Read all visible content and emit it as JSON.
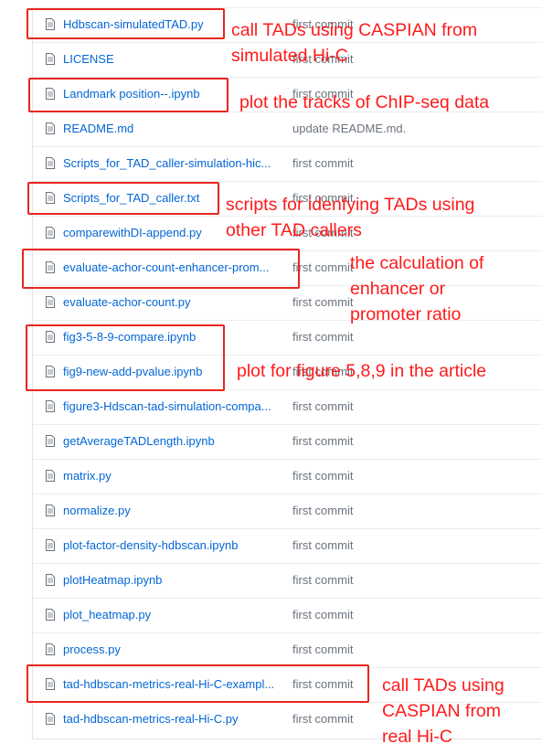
{
  "files": [
    {
      "name": "Hdbscan-simulatedTAD.py",
      "message": "first commit"
    },
    {
      "name": "LICENSE",
      "message": "first commit"
    },
    {
      "name": "Landmark position--.ipynb",
      "message": "first commit"
    },
    {
      "name": "README.md",
      "message": "update README.md."
    },
    {
      "name": "Scripts_for_TAD_caller-simulation-hic...",
      "message": "first commit"
    },
    {
      "name": "Scripts_for_TAD_caller.txt",
      "message": "first commit"
    },
    {
      "name": "comparewithDI-append.py",
      "message": "first commit"
    },
    {
      "name": "evaluate-achor-count-enhancer-prom...",
      "message": "first commit"
    },
    {
      "name": "evaluate-achor-count.py",
      "message": "first commit"
    },
    {
      "name": "fig3-5-8-9-compare.ipynb",
      "message": "first commit"
    },
    {
      "name": "fig9-new-add-pvalue.ipynb",
      "message": "first commit"
    },
    {
      "name": "figure3-Hdscan-tad-simulation-compa...",
      "message": "first commit"
    },
    {
      "name": "getAverageTADLength.ipynb",
      "message": "first commit"
    },
    {
      "name": "matrix.py",
      "message": "first commit"
    },
    {
      "name": "normalize.py",
      "message": "first commit"
    },
    {
      "name": "plot-factor-density-hdbscan.ipynb",
      "message": "first commit"
    },
    {
      "name": "plotHeatmap.ipynb",
      "message": "first commit"
    },
    {
      "name": "plot_heatmap.py",
      "message": "first commit"
    },
    {
      "name": "process.py",
      "message": "first commit"
    },
    {
      "name": "tad-hdbscan-metrics-real-Hi-C-exampl...",
      "message": "first commit"
    },
    {
      "name": "tad-hdbscan-metrics-real-Hi-C.py",
      "message": "first commit"
    }
  ],
  "annotations": {
    "a1_line1": "call TADs using CASPIAN from",
    "a1_line2": "simulated Hi-C",
    "a2": "plot the tracks of ChIP-seq data",
    "a3_line1": "scripts for idenfying TADs using",
    "a3_line2": "other TAD callers",
    "a4_line1": "the calculation of",
    "a4_line2": "enhancer or",
    "a4_line3": "promoter ratio",
    "a5": "plot for figure 5,8,9 in the article",
    "a6_line1": "call TADs using",
    "a6_line2": "CASPIAN from",
    "a6_line3": "real Hi-C"
  },
  "colors": {
    "link": "#0366d6",
    "muted": "#6a737d",
    "annotation": "#ff1a1a",
    "highlight_box": "#e8261f"
  }
}
